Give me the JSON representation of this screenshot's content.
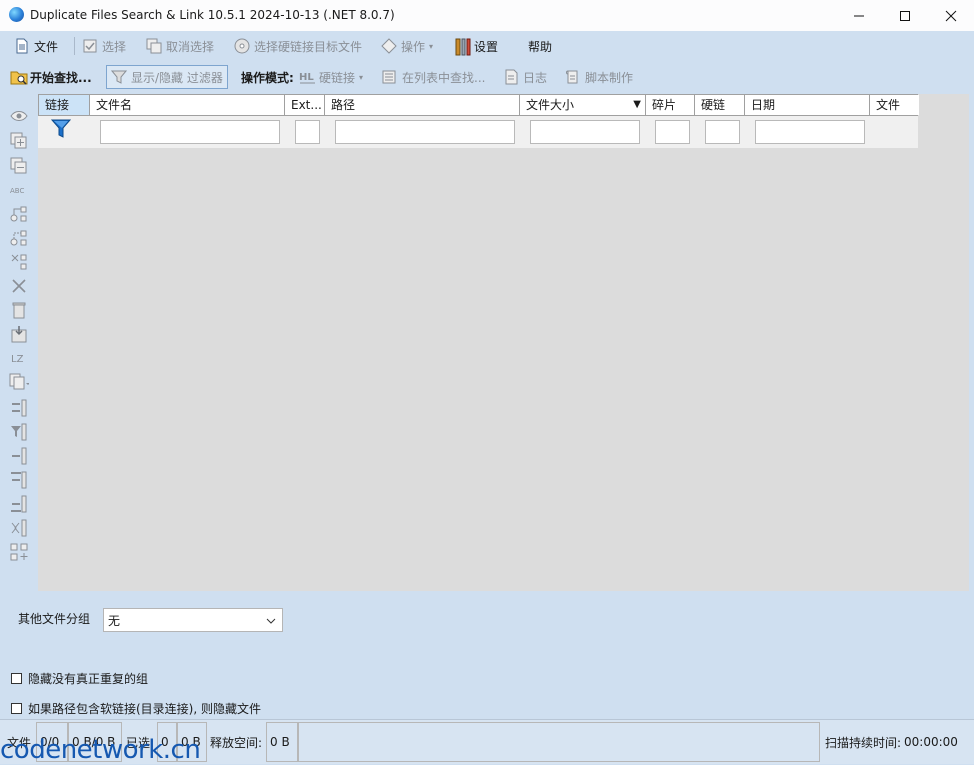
{
  "window": {
    "title": "Duplicate Files Search & Link 10.5.1 2024-10-13 (.NET 8.0.7)"
  },
  "menubar": {
    "file": "文件",
    "select": "选择",
    "deselect": "取消选择",
    "select_hardlink_target": "选择硬链接目标文件",
    "operation": "操作",
    "settings": "设置",
    "help": "帮助"
  },
  "toolbar": {
    "start_search": "开始查找...",
    "show_hide_filter": "显示/隐藏 过滤器",
    "operation_mode_label": "操作模式:",
    "hardlink": "硬链接",
    "find_in_list": "在列表中查找...",
    "log": "日志",
    "script": "脚本制作"
  },
  "grid": {
    "columns": [
      "链接",
      "文件名",
      "Ext...",
      "路径",
      "文件大小",
      "碎片",
      "硬链",
      "日期",
      "文件"
    ]
  },
  "lower": {
    "group_label": "其他文件分组",
    "group_value": "无",
    "hide_non_dup_groups": "隐藏没有真正重复的组",
    "hide_symlink_paths": "如果路径包含软链接(目录连接), 则隐藏文件"
  },
  "status": {
    "files_label": "文件",
    "files_count": "0/0",
    "files_size": "0 B/0 B",
    "selected_label": "已选:",
    "selected_count": "0",
    "selected_size": "0 B",
    "free_label": "释放空间:",
    "free_value": "0 B",
    "scan_time_label": "扫描持续时间:",
    "scan_time_value": "00:00:00"
  },
  "watermark": "codenetwork.cn",
  "colors": {
    "background": "#cfdff0",
    "grid_background": "#dcdcdc",
    "header_selected": "#cce3f7",
    "filter_icon": "#1a6fc9"
  }
}
